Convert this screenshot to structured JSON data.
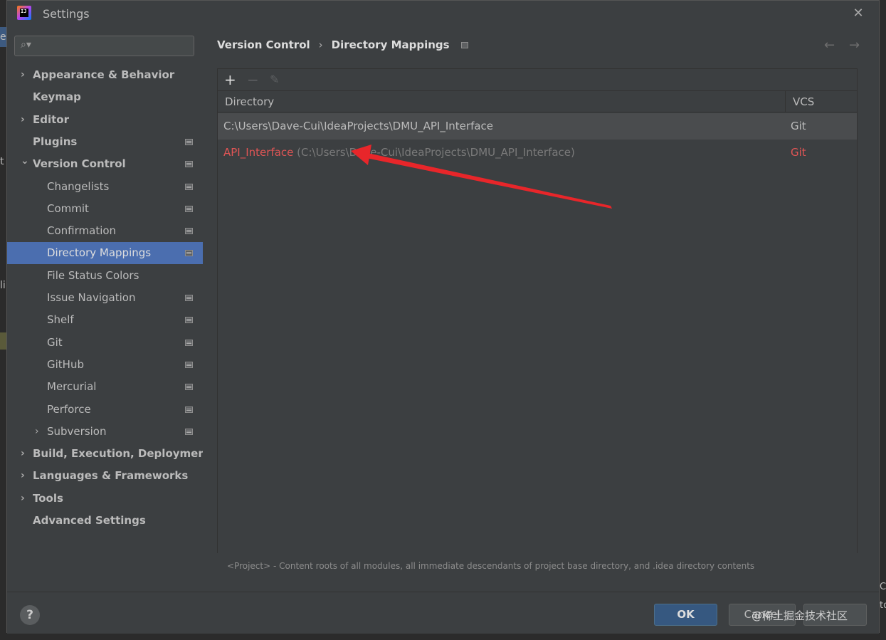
{
  "window": {
    "title": "Settings",
    "close_icon": "close-icon"
  },
  "background": {
    "left_texts": [
      "e",
      "t",
      "li"
    ],
    "right_texts": [
      "C",
      "to"
    ]
  },
  "search": {
    "placeholder": "",
    "icon": "search-icon"
  },
  "sidebar": {
    "items": [
      {
        "label": "Appearance & Behavior",
        "expandable": true,
        "expanded": false,
        "bold": true,
        "indent": 0,
        "page_icon": false,
        "selected": false
      },
      {
        "label": "Keymap",
        "expandable": false,
        "bold": true,
        "indent": 0,
        "page_icon": false,
        "selected": false
      },
      {
        "label": "Editor",
        "expandable": true,
        "expanded": false,
        "bold": true,
        "indent": 0,
        "page_icon": false,
        "selected": false
      },
      {
        "label": "Plugins",
        "expandable": false,
        "bold": true,
        "indent": 0,
        "page_icon": true,
        "selected": false
      },
      {
        "label": "Version Control",
        "expandable": true,
        "expanded": true,
        "bold": true,
        "indent": 0,
        "page_icon": true,
        "selected": false
      },
      {
        "label": "Changelists",
        "expandable": false,
        "bold": false,
        "indent": 1,
        "page_icon": true,
        "selected": false
      },
      {
        "label": "Commit",
        "expandable": false,
        "bold": false,
        "indent": 1,
        "page_icon": true,
        "selected": false
      },
      {
        "label": "Confirmation",
        "expandable": false,
        "bold": false,
        "indent": 1,
        "page_icon": true,
        "selected": false
      },
      {
        "label": "Directory Mappings",
        "expandable": false,
        "bold": false,
        "indent": 1,
        "page_icon": true,
        "selected": true
      },
      {
        "label": "File Status Colors",
        "expandable": false,
        "bold": false,
        "indent": 1,
        "page_icon": false,
        "selected": false
      },
      {
        "label": "Issue Navigation",
        "expandable": false,
        "bold": false,
        "indent": 1,
        "page_icon": true,
        "selected": false
      },
      {
        "label": "Shelf",
        "expandable": false,
        "bold": false,
        "indent": 1,
        "page_icon": true,
        "selected": false
      },
      {
        "label": "Git",
        "expandable": false,
        "bold": false,
        "indent": 1,
        "page_icon": true,
        "selected": false
      },
      {
        "label": "GitHub",
        "expandable": false,
        "bold": false,
        "indent": 1,
        "page_icon": true,
        "selected": false
      },
      {
        "label": "Mercurial",
        "expandable": false,
        "bold": false,
        "indent": 1,
        "page_icon": true,
        "selected": false
      },
      {
        "label": "Perforce",
        "expandable": false,
        "bold": false,
        "indent": 1,
        "page_icon": true,
        "selected": false
      },
      {
        "label": "Subversion",
        "expandable": true,
        "expanded": false,
        "bold": false,
        "indent": 1,
        "page_icon": true,
        "selected": false
      },
      {
        "label": "Build, Execution, Deployment",
        "expandable": true,
        "expanded": false,
        "bold": true,
        "indent": 0,
        "page_icon": false,
        "selected": false
      },
      {
        "label": "Languages & Frameworks",
        "expandable": true,
        "expanded": false,
        "bold": true,
        "indent": 0,
        "page_icon": false,
        "selected": false
      },
      {
        "label": "Tools",
        "expandable": true,
        "expanded": false,
        "bold": true,
        "indent": 0,
        "page_icon": false,
        "selected": false
      },
      {
        "label": "Advanced Settings",
        "expandable": false,
        "bold": true,
        "indent": 0,
        "page_icon": false,
        "selected": false
      }
    ]
  },
  "breadcrumb": {
    "parent": "Version Control",
    "separator": "›",
    "current": "Directory Mappings"
  },
  "nav": {
    "back": "←",
    "forward": "→"
  },
  "toolbar": {
    "add": "+",
    "remove": "−",
    "edit": "✎"
  },
  "table": {
    "headers": {
      "directory": "Directory",
      "vcs": "VCS"
    },
    "rows": [
      {
        "directory": "C:\\Users\\Dave-Cui\\IdeaProjects\\DMU_API_Interface",
        "vcs": "Git"
      },
      {
        "name": "API_Interface",
        "path": " (C:\\Users\\Dave-Cui\\IdeaProjects\\DMU_API_Interface)",
        "vcs": "Git"
      }
    ]
  },
  "footnote": "<Project> - Content roots of all modules, all immediate descendants of project base directory, and .idea directory contents",
  "footer": {
    "help": "?",
    "ok": "OK",
    "cancel": "Cancel",
    "apply": "",
    "watermark": "@稀土掘金技术社区"
  },
  "colors": {
    "accent": "#4b6eaf",
    "error_red": "#e05555",
    "annotation_arrow": "#e8262a",
    "ok_button": "#365880"
  }
}
